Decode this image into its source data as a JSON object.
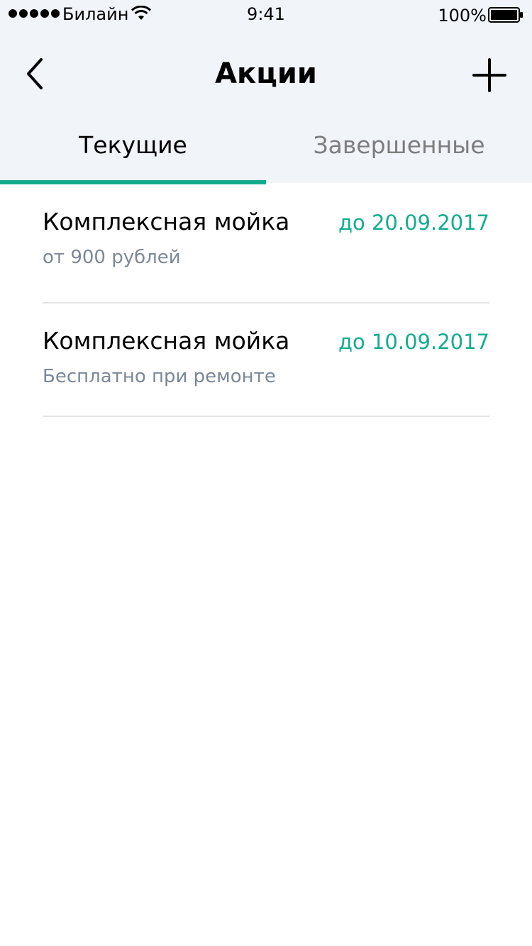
{
  "status_bar": {
    "carrier": "Билайн",
    "time": "9:41",
    "battery": "100%",
    "signal_icon": "signal-dots-icon",
    "wifi_icon": "wifi-icon",
    "battery_icon": "battery-icon"
  },
  "nav": {
    "title": "Акции",
    "back_icon": "chevron-left-icon",
    "add_icon": "plus-icon"
  },
  "tabs": [
    {
      "label": "Текущие",
      "active": true
    },
    {
      "label": "Завершенные",
      "active": false
    }
  ],
  "promotions": [
    {
      "title": "Комплексная мойка",
      "date": "до 20.09.2017",
      "subtitle": "от 900 рублей"
    },
    {
      "title": "Комплексная мойка",
      "date": "до 10.09.2017",
      "subtitle": "Бесплатно при ремонте"
    }
  ],
  "colors": {
    "accent": "#13ad8e",
    "header_bg": "#f1f4f9",
    "subtitle": "#7c8898",
    "inactive_tab": "#7d7d7d",
    "divider": "#e4e4e4"
  }
}
